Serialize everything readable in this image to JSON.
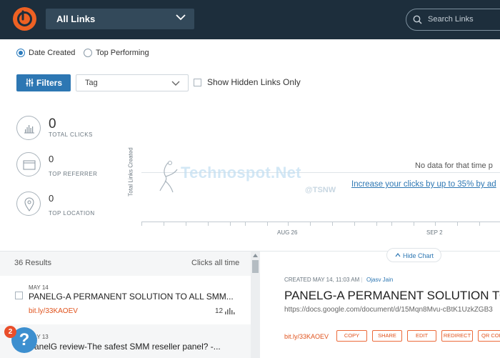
{
  "header": {
    "links_dropdown": "All Links",
    "search_placeholder": "Search Links"
  },
  "sort": {
    "options": [
      {
        "label": "Date Created",
        "selected": true
      },
      {
        "label": "Top Performing",
        "selected": false
      }
    ]
  },
  "filters": {
    "button_label": "Filters",
    "tag_placeholder": "Tag",
    "hidden_checkbox_label": "Show Hidden Links Only"
  },
  "stats": [
    {
      "value": "0",
      "label": "TOTAL CLICKS",
      "icon": "bar-chart-icon"
    },
    {
      "value": "0",
      "label": "TOP REFERRER",
      "icon": "browser-window-icon"
    },
    {
      "value": "0",
      "label": "TOP LOCATION",
      "icon": "location-pin-icon"
    }
  ],
  "chart": {
    "y_axis_title": "Total Links Created",
    "no_data_text": "No data for that time p",
    "increase_link": "Increase your clicks by up to 35% by ad",
    "x_ticks": [
      "AUG 26",
      "SEP 2"
    ],
    "hide_chart_label": "Hide Chart"
  },
  "watermark": {
    "text": "Technospot.Net",
    "handle": "@TSNW"
  },
  "links_list": {
    "results_count": "36 Results",
    "clicks_header": "Clicks all time",
    "items": [
      {
        "date": "MAY 14",
        "title": "PANELG-A PERMANENT SOLUTION TO ALL SMM...",
        "short_link": "bit.ly/33KAOEV",
        "clicks": "12"
      },
      {
        "date": "MAY 13",
        "title": "PanelG review-The safest SMM reseller panel? -...",
        "short_link": "",
        "clicks": ""
      }
    ]
  },
  "detail": {
    "created": "CREATED MAY 14, 11:03 AM",
    "separator": "|",
    "author": "Ojasv Jain",
    "title": "PANELG-A PERMANENT SOLUTION TO",
    "long_url": "https://docs.google.com/document/d/15Mqn8Mvu-cBtK1UzkZGB3",
    "short_link": "bit.ly/33KAOEV",
    "actions": [
      "COPY",
      "SHARE",
      "EDIT",
      "REDIRECT",
      "QR COD"
    ]
  },
  "help": {
    "symbol": "?",
    "badge_count": "2"
  },
  "colors": {
    "header_bg": "#1d2e3c",
    "brand_orange": "#ee6123",
    "accent_blue": "#2d77b3",
    "link_orange": "#e0531d"
  }
}
